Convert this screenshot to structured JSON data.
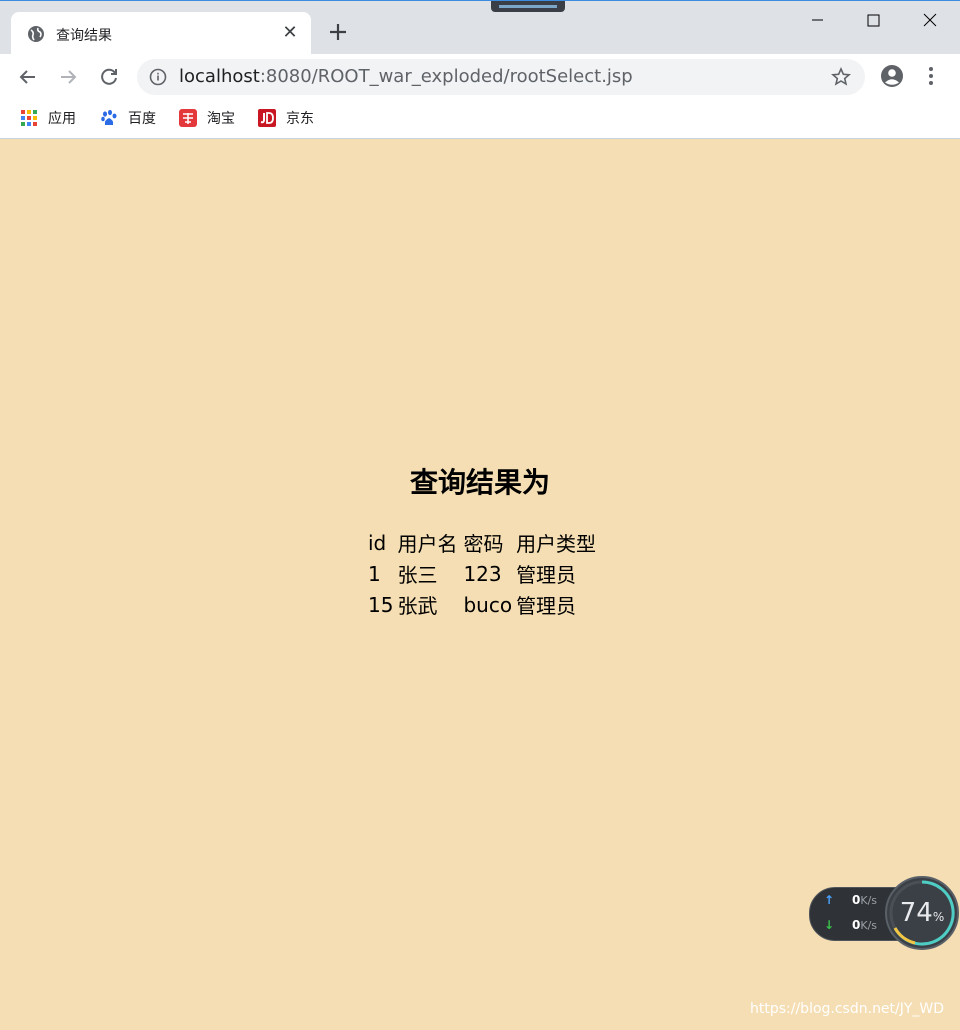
{
  "browser": {
    "tab": {
      "title": "查询结果",
      "favicon": "globe-icon"
    },
    "url": {
      "host": "localhost",
      "rest": ":8080/ROOT_war_exploded/rootSelect.jsp"
    },
    "bookmarks": [
      {
        "label": "应用",
        "icon": "apps-grid-icon"
      },
      {
        "label": "百度",
        "icon": "baidu-paw-icon"
      },
      {
        "label": "淘宝",
        "icon": "taobao-icon"
      },
      {
        "label": "京东",
        "icon": "jd-icon"
      }
    ],
    "accent_color": "#3c8de0"
  },
  "page": {
    "background_color": "#f5deb3",
    "heading": "查询结果为",
    "table": {
      "headers": [
        "id",
        "用户名",
        "密码",
        "用户类型"
      ],
      "rows": [
        [
          "1",
          "张三",
          "123",
          "管理员"
        ],
        [
          "15",
          "张武",
          "buco",
          "管理员"
        ]
      ]
    }
  },
  "overlay": {
    "upload": {
      "value": "0",
      "unit": "K/s"
    },
    "download": {
      "value": "0",
      "unit": "K/s"
    },
    "gauge": {
      "value": "74",
      "unit": "%"
    },
    "watermark": "https://blog.csdn.net/JY_WD"
  }
}
